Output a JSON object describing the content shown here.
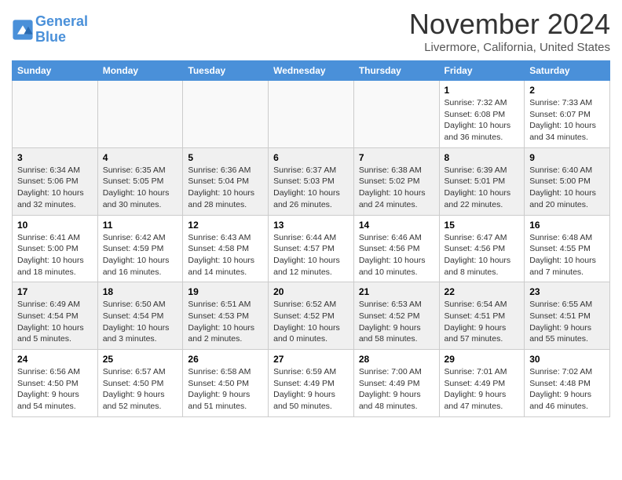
{
  "header": {
    "logo_line1": "General",
    "logo_line2": "Blue",
    "month_title": "November 2024",
    "location": "Livermore, California, United States"
  },
  "weekdays": [
    "Sunday",
    "Monday",
    "Tuesday",
    "Wednesday",
    "Thursday",
    "Friday",
    "Saturday"
  ],
  "weeks": [
    [
      {
        "day": "",
        "info": ""
      },
      {
        "day": "",
        "info": ""
      },
      {
        "day": "",
        "info": ""
      },
      {
        "day": "",
        "info": ""
      },
      {
        "day": "",
        "info": ""
      },
      {
        "day": "1",
        "info": "Sunrise: 7:32 AM\nSunset: 6:08 PM\nDaylight: 10 hours and 36 minutes."
      },
      {
        "day": "2",
        "info": "Sunrise: 7:33 AM\nSunset: 6:07 PM\nDaylight: 10 hours and 34 minutes."
      }
    ],
    [
      {
        "day": "3",
        "info": "Sunrise: 6:34 AM\nSunset: 5:06 PM\nDaylight: 10 hours and 32 minutes."
      },
      {
        "day": "4",
        "info": "Sunrise: 6:35 AM\nSunset: 5:05 PM\nDaylight: 10 hours and 30 minutes."
      },
      {
        "day": "5",
        "info": "Sunrise: 6:36 AM\nSunset: 5:04 PM\nDaylight: 10 hours and 28 minutes."
      },
      {
        "day": "6",
        "info": "Sunrise: 6:37 AM\nSunset: 5:03 PM\nDaylight: 10 hours and 26 minutes."
      },
      {
        "day": "7",
        "info": "Sunrise: 6:38 AM\nSunset: 5:02 PM\nDaylight: 10 hours and 24 minutes."
      },
      {
        "day": "8",
        "info": "Sunrise: 6:39 AM\nSunset: 5:01 PM\nDaylight: 10 hours and 22 minutes."
      },
      {
        "day": "9",
        "info": "Sunrise: 6:40 AM\nSunset: 5:00 PM\nDaylight: 10 hours and 20 minutes."
      }
    ],
    [
      {
        "day": "10",
        "info": "Sunrise: 6:41 AM\nSunset: 5:00 PM\nDaylight: 10 hours and 18 minutes."
      },
      {
        "day": "11",
        "info": "Sunrise: 6:42 AM\nSunset: 4:59 PM\nDaylight: 10 hours and 16 minutes."
      },
      {
        "day": "12",
        "info": "Sunrise: 6:43 AM\nSunset: 4:58 PM\nDaylight: 10 hours and 14 minutes."
      },
      {
        "day": "13",
        "info": "Sunrise: 6:44 AM\nSunset: 4:57 PM\nDaylight: 10 hours and 12 minutes."
      },
      {
        "day": "14",
        "info": "Sunrise: 6:46 AM\nSunset: 4:56 PM\nDaylight: 10 hours and 10 minutes."
      },
      {
        "day": "15",
        "info": "Sunrise: 6:47 AM\nSunset: 4:56 PM\nDaylight: 10 hours and 8 minutes."
      },
      {
        "day": "16",
        "info": "Sunrise: 6:48 AM\nSunset: 4:55 PM\nDaylight: 10 hours and 7 minutes."
      }
    ],
    [
      {
        "day": "17",
        "info": "Sunrise: 6:49 AM\nSunset: 4:54 PM\nDaylight: 10 hours and 5 minutes."
      },
      {
        "day": "18",
        "info": "Sunrise: 6:50 AM\nSunset: 4:54 PM\nDaylight: 10 hours and 3 minutes."
      },
      {
        "day": "19",
        "info": "Sunrise: 6:51 AM\nSunset: 4:53 PM\nDaylight: 10 hours and 2 minutes."
      },
      {
        "day": "20",
        "info": "Sunrise: 6:52 AM\nSunset: 4:52 PM\nDaylight: 10 hours and 0 minutes."
      },
      {
        "day": "21",
        "info": "Sunrise: 6:53 AM\nSunset: 4:52 PM\nDaylight: 9 hours and 58 minutes."
      },
      {
        "day": "22",
        "info": "Sunrise: 6:54 AM\nSunset: 4:51 PM\nDaylight: 9 hours and 57 minutes."
      },
      {
        "day": "23",
        "info": "Sunrise: 6:55 AM\nSunset: 4:51 PM\nDaylight: 9 hours and 55 minutes."
      }
    ],
    [
      {
        "day": "24",
        "info": "Sunrise: 6:56 AM\nSunset: 4:50 PM\nDaylight: 9 hours and 54 minutes."
      },
      {
        "day": "25",
        "info": "Sunrise: 6:57 AM\nSunset: 4:50 PM\nDaylight: 9 hours and 52 minutes."
      },
      {
        "day": "26",
        "info": "Sunrise: 6:58 AM\nSunset: 4:50 PM\nDaylight: 9 hours and 51 minutes."
      },
      {
        "day": "27",
        "info": "Sunrise: 6:59 AM\nSunset: 4:49 PM\nDaylight: 9 hours and 50 minutes."
      },
      {
        "day": "28",
        "info": "Sunrise: 7:00 AM\nSunset: 4:49 PM\nDaylight: 9 hours and 48 minutes."
      },
      {
        "day": "29",
        "info": "Sunrise: 7:01 AM\nSunset: 4:49 PM\nDaylight: 9 hours and 47 minutes."
      },
      {
        "day": "30",
        "info": "Sunrise: 7:02 AM\nSunset: 4:48 PM\nDaylight: 9 hours and 46 minutes."
      }
    ]
  ]
}
